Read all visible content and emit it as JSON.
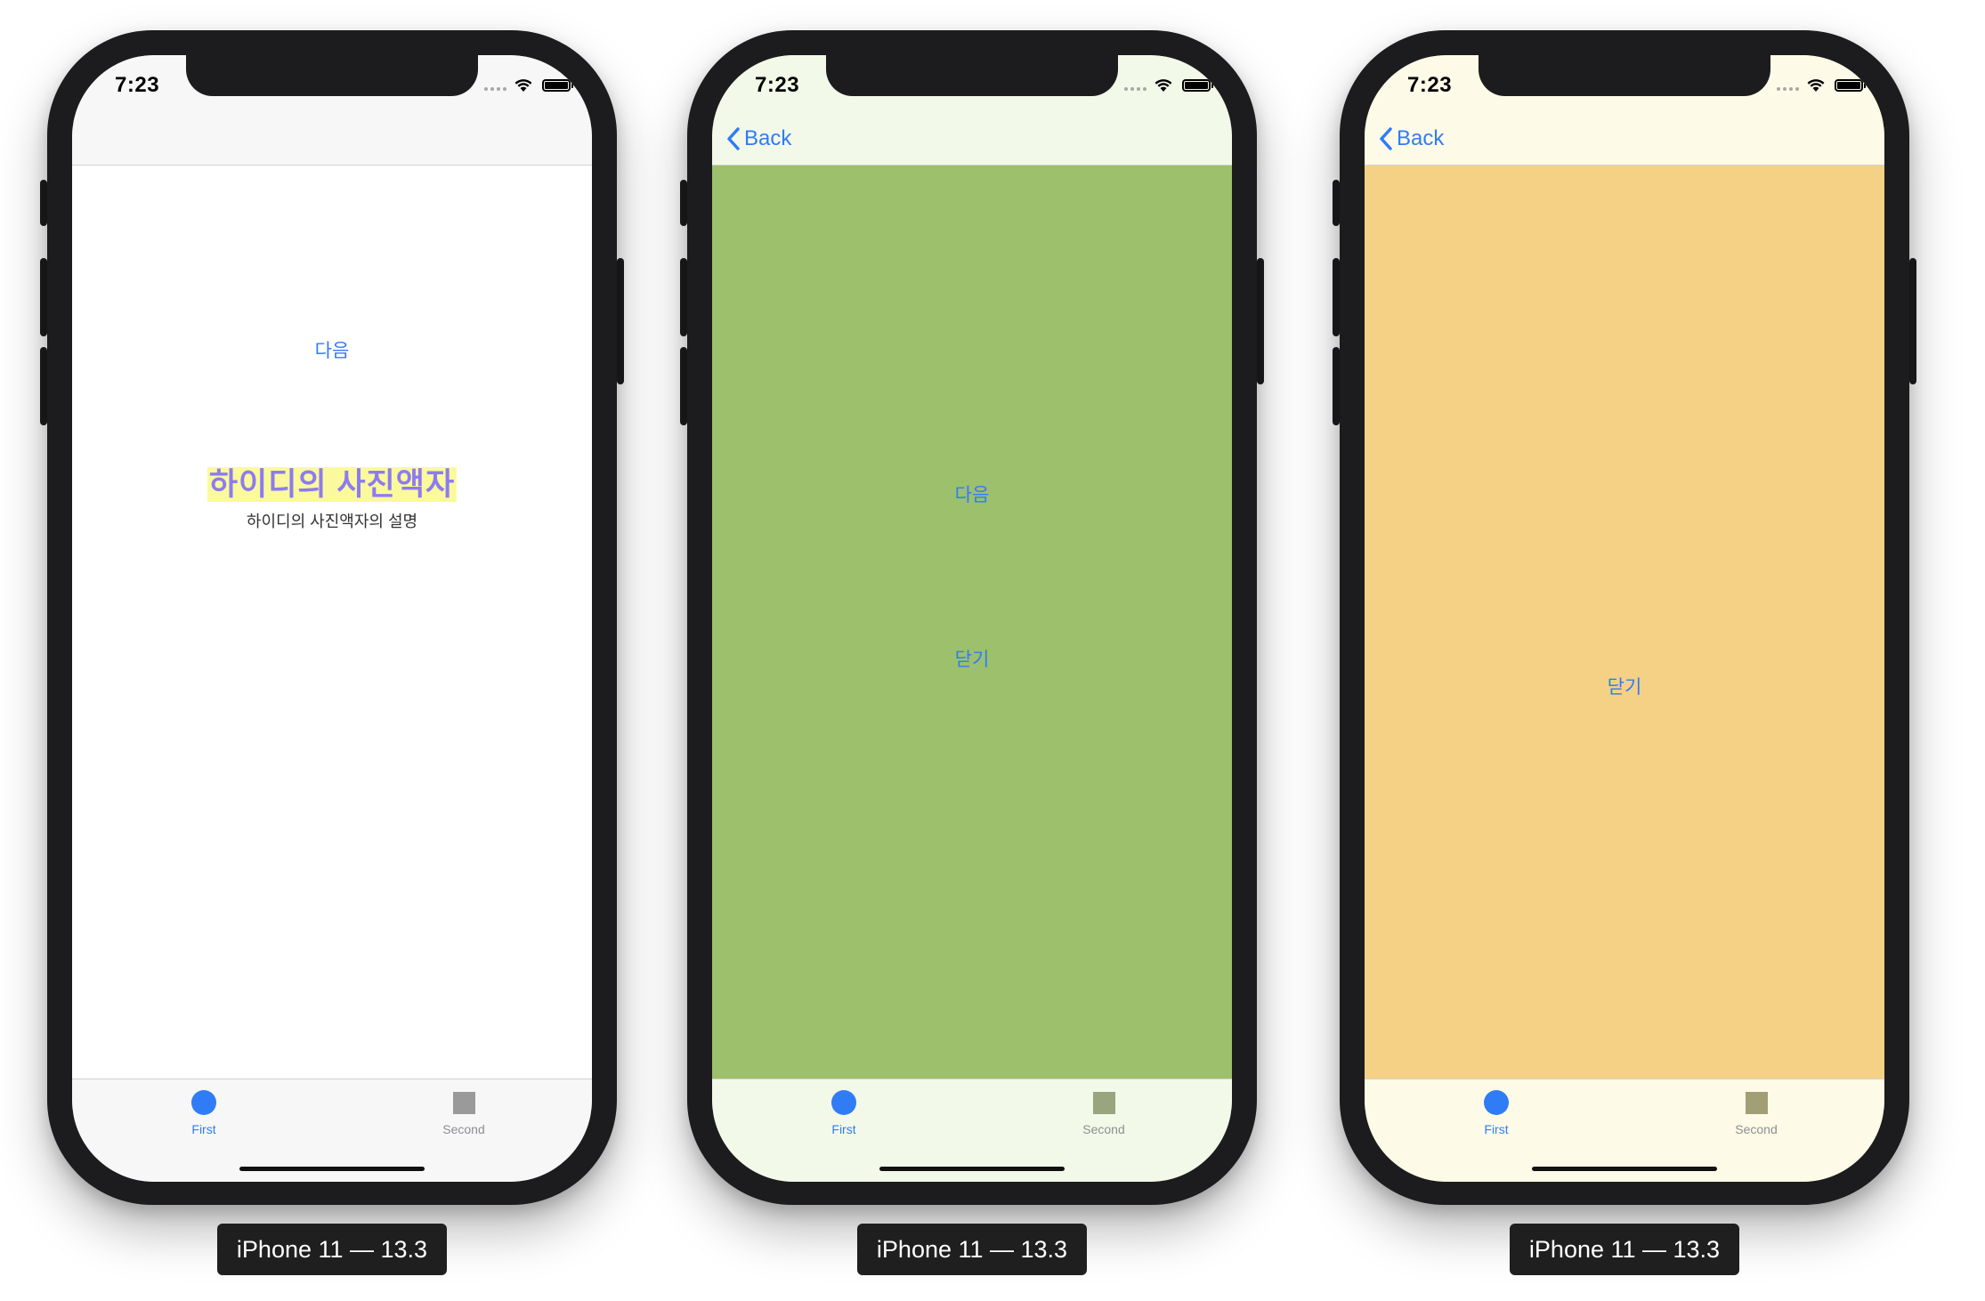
{
  "colors": {
    "tint": "#2f7cf6",
    "green_content": "#9cc06b",
    "amber_content": "#f5d185"
  },
  "devices": [
    {
      "caption": "iPhone 11 — 13.3",
      "status_time": "7:23",
      "back_label": "",
      "next_label": "다음",
      "title": "하이디의 사진액자",
      "subtitle": "하이디의 사진액자의 설명",
      "tabs": [
        {
          "label": "First",
          "icon": "circle-filled-icon",
          "selected": true
        },
        {
          "label": "Second",
          "icon": "square-icon",
          "selected": false
        }
      ]
    },
    {
      "caption": "iPhone 11 — 13.3",
      "status_time": "7:23",
      "back_label": "Back",
      "next_label": "다음",
      "close_label": "닫기",
      "tabs": [
        {
          "label": "First",
          "icon": "circle-filled-icon",
          "selected": true
        },
        {
          "label": "Second",
          "icon": "square-icon",
          "selected": false
        }
      ]
    },
    {
      "caption": "iPhone 11 — 13.3",
      "status_time": "7:23",
      "back_label": "Back",
      "close_label": "닫기",
      "tabs": [
        {
          "label": "First",
          "icon": "circle-filled-icon",
          "selected": true
        },
        {
          "label": "Second",
          "icon": "square-icon",
          "selected": false
        }
      ]
    }
  ]
}
